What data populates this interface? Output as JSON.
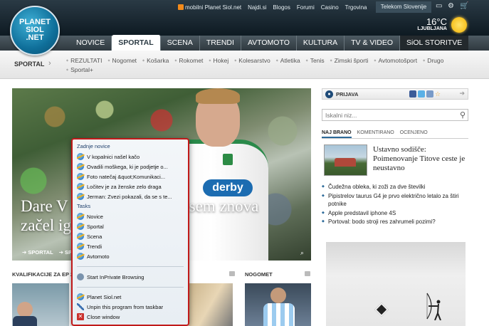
{
  "header": {
    "logo": {
      "line1": "PLANET",
      "line2": "SIOL",
      "line3": ".NET"
    },
    "toplinks": [
      "mobilni Planet Siol.net",
      "Najdi.si",
      "Blogos",
      "Forumi",
      "Casino",
      "Trgovina"
    ],
    "telekom": "Telekom Slovenije",
    "weather": {
      "temp": "16°C",
      "city": "LJUBLJANA"
    }
  },
  "nav": {
    "items": [
      "NOVICE",
      "SPORTAL",
      "SCENA",
      "TRENDI",
      "AVTOMOTO",
      "KULTURA",
      "TV & VIDEO",
      "SiOL STORITVE"
    ],
    "active": "SPORTAL"
  },
  "subnav": {
    "title": "SPORTAL",
    "links": [
      "REZULTATI",
      "Nogomet",
      "Košarka",
      "Rokomet",
      "Hokej",
      "Kolesarstvo",
      "Atletika",
      "Tenis",
      "Zimski športi",
      "Avtomotošport",
      "Drugo",
      "Sportal+"
    ]
  },
  "hero": {
    "sponsor": "derby",
    "title_left_1": "Dare V",
    "title_right_1": "sem znova",
    "title_left_2": "začel ig",
    "tags": [
      "SPORTAL",
      "SPOR"
    ]
  },
  "bottom": {
    "sec1": "KVALIFIKACIJE ZA EP 20",
    "sec2": "NOGOMET"
  },
  "right": {
    "login": "PRIJAVA",
    "search_placeholder": "Iskalni niz...",
    "tabs": [
      "NAJ BRANO",
      "KOMENTIRANO",
      "OCENJENO"
    ],
    "top_news": "Ustavno sodišče: Poimenovanje Titove ceste je neustavno",
    "news": [
      "Čudežna obleka, ki zoži za dve številki",
      "Pipistrelov taurus G4 je prvo električno letalo za štiri potnike",
      "Apple predstavil iphone 4S",
      "Portoval: bodo stroji res zahrumeli pozimi?"
    ]
  },
  "jumplist": {
    "recent_title": "Zadnje novice",
    "recent": [
      "V kopalnici našel kačo",
      "Ovadili moškega, ki je podjetje o...",
      "Foto natečaj &quot;Komunikaci...",
      "Ločitev je za ženske zelo draga",
      "Jerman: Zvezi pokazali, da se s te..."
    ],
    "tasks_title": "Tasks",
    "tasks": [
      "Novice",
      "Sportal",
      "Scena",
      "Trendi",
      "Avtomoto"
    ],
    "inprivate": "Start InPrivate Browsing",
    "app": "Planet Siol.net",
    "unpin": "Unpin this program from taskbar",
    "close": "Close window"
  }
}
